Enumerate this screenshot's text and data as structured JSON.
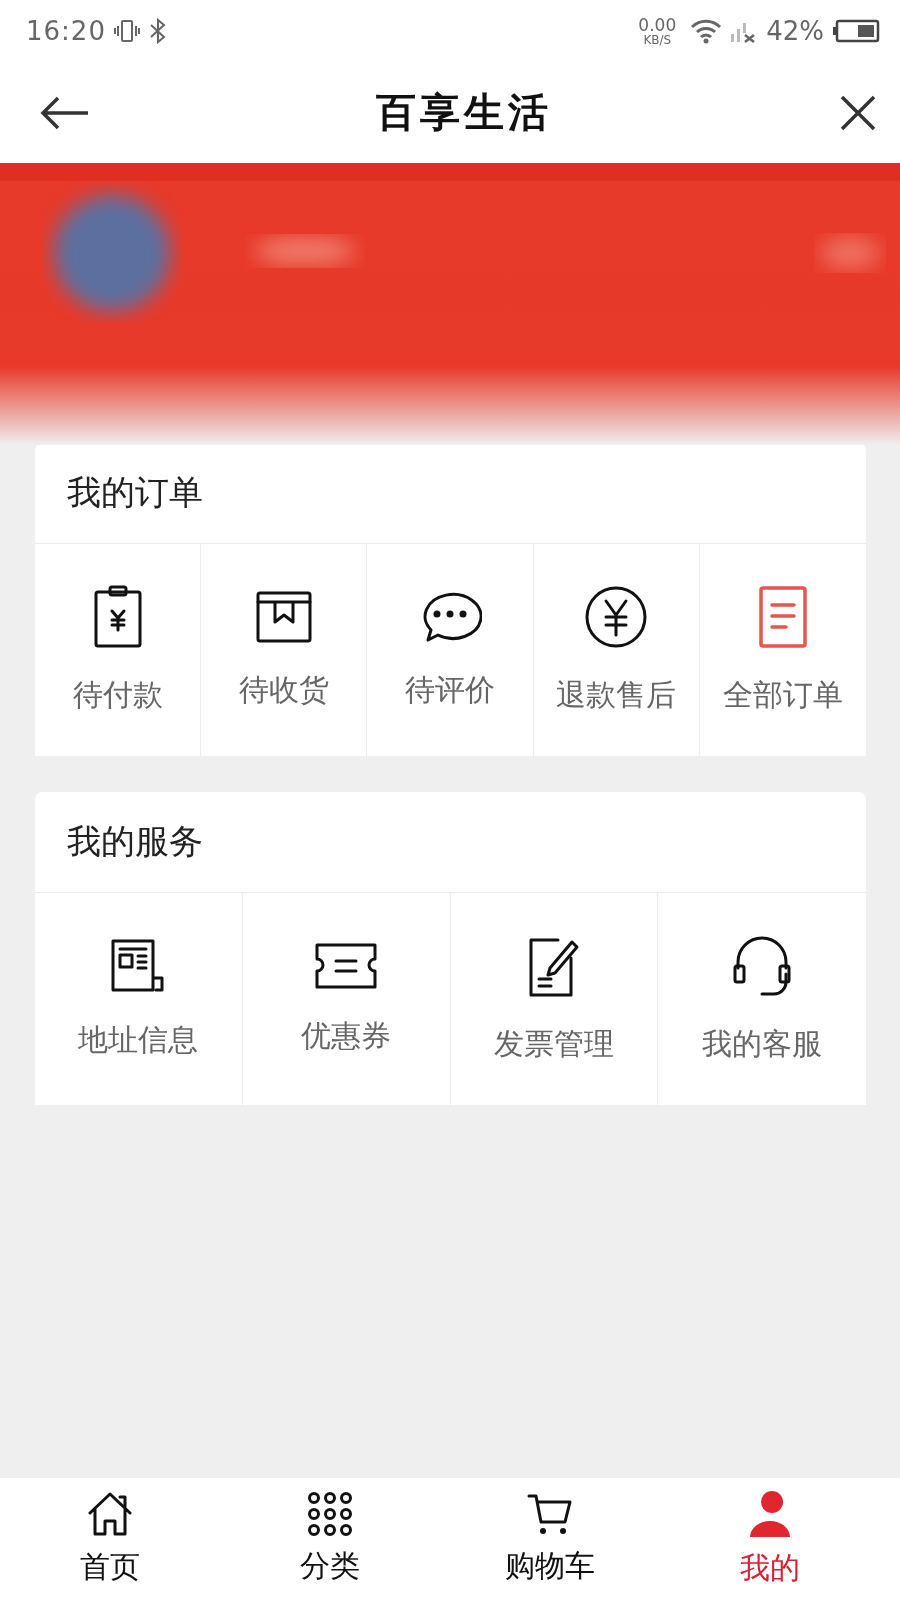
{
  "status_bar": {
    "time": "16:20",
    "net_speed": "0.00",
    "net_unit": "KB/S",
    "battery": "42%"
  },
  "nav": {
    "title": "百享生活"
  },
  "orders": {
    "title": "我的订单",
    "items": [
      {
        "label": "待付款"
      },
      {
        "label": "待收货"
      },
      {
        "label": "待评价"
      },
      {
        "label": "退款售后"
      },
      {
        "label": "全部订单"
      }
    ]
  },
  "services": {
    "title": "我的服务",
    "items": [
      {
        "label": "地址信息"
      },
      {
        "label": "优惠券"
      },
      {
        "label": "发票管理"
      },
      {
        "label": "我的客服"
      }
    ]
  },
  "tab_bar": [
    {
      "label": "首页",
      "selected": false
    },
    {
      "label": "分类",
      "selected": false
    },
    {
      "label": "购物车",
      "selected": false
    },
    {
      "label": "我的",
      "selected": true
    }
  ]
}
